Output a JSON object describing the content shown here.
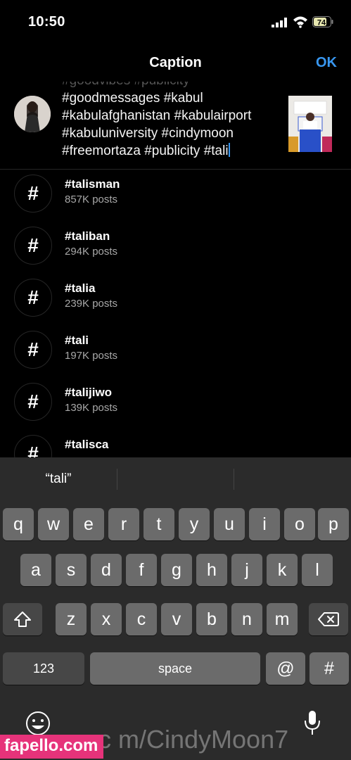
{
  "status_bar": {
    "time": "10:50",
    "battery": "74"
  },
  "header": {
    "title": "Caption",
    "ok_label": "OK"
  },
  "caption": {
    "lines": [
      "#goodmessages #kabul",
      "#kabulafghanistan #kabulairport",
      "#kabuluniversity #cindymoon",
      "#freemortaza #publicity #tali"
    ]
  },
  "hashtags": [
    {
      "name": "#talisman",
      "count": "857K posts"
    },
    {
      "name": "#taliban",
      "count": "294K posts"
    },
    {
      "name": "#talia",
      "count": "239K posts"
    },
    {
      "name": "#tali",
      "count": "197K posts"
    },
    {
      "name": "#talijiwo",
      "count": "139K posts"
    },
    {
      "name": "#talisca",
      "count": ""
    }
  ],
  "hashtag_symbol": "#",
  "keyboard": {
    "prediction": "“tali”",
    "row1": [
      "q",
      "w",
      "e",
      "r",
      "t",
      "y",
      "u",
      "i",
      "o",
      "p"
    ],
    "row2": [
      "a",
      "s",
      "d",
      "f",
      "g",
      "h",
      "j",
      "k",
      "l"
    ],
    "row3": [
      "z",
      "x",
      "c",
      "v",
      "b",
      "n",
      "m"
    ],
    "numbers_label": "123",
    "space_label": "space",
    "at_label": "@",
    "hash_label": "#"
  },
  "watermark": {
    "site": "fapello.com",
    "handle": "c m/CindyMoon7"
  },
  "colors": {
    "accent": "#3897f0",
    "watermark": "#e6337a"
  }
}
